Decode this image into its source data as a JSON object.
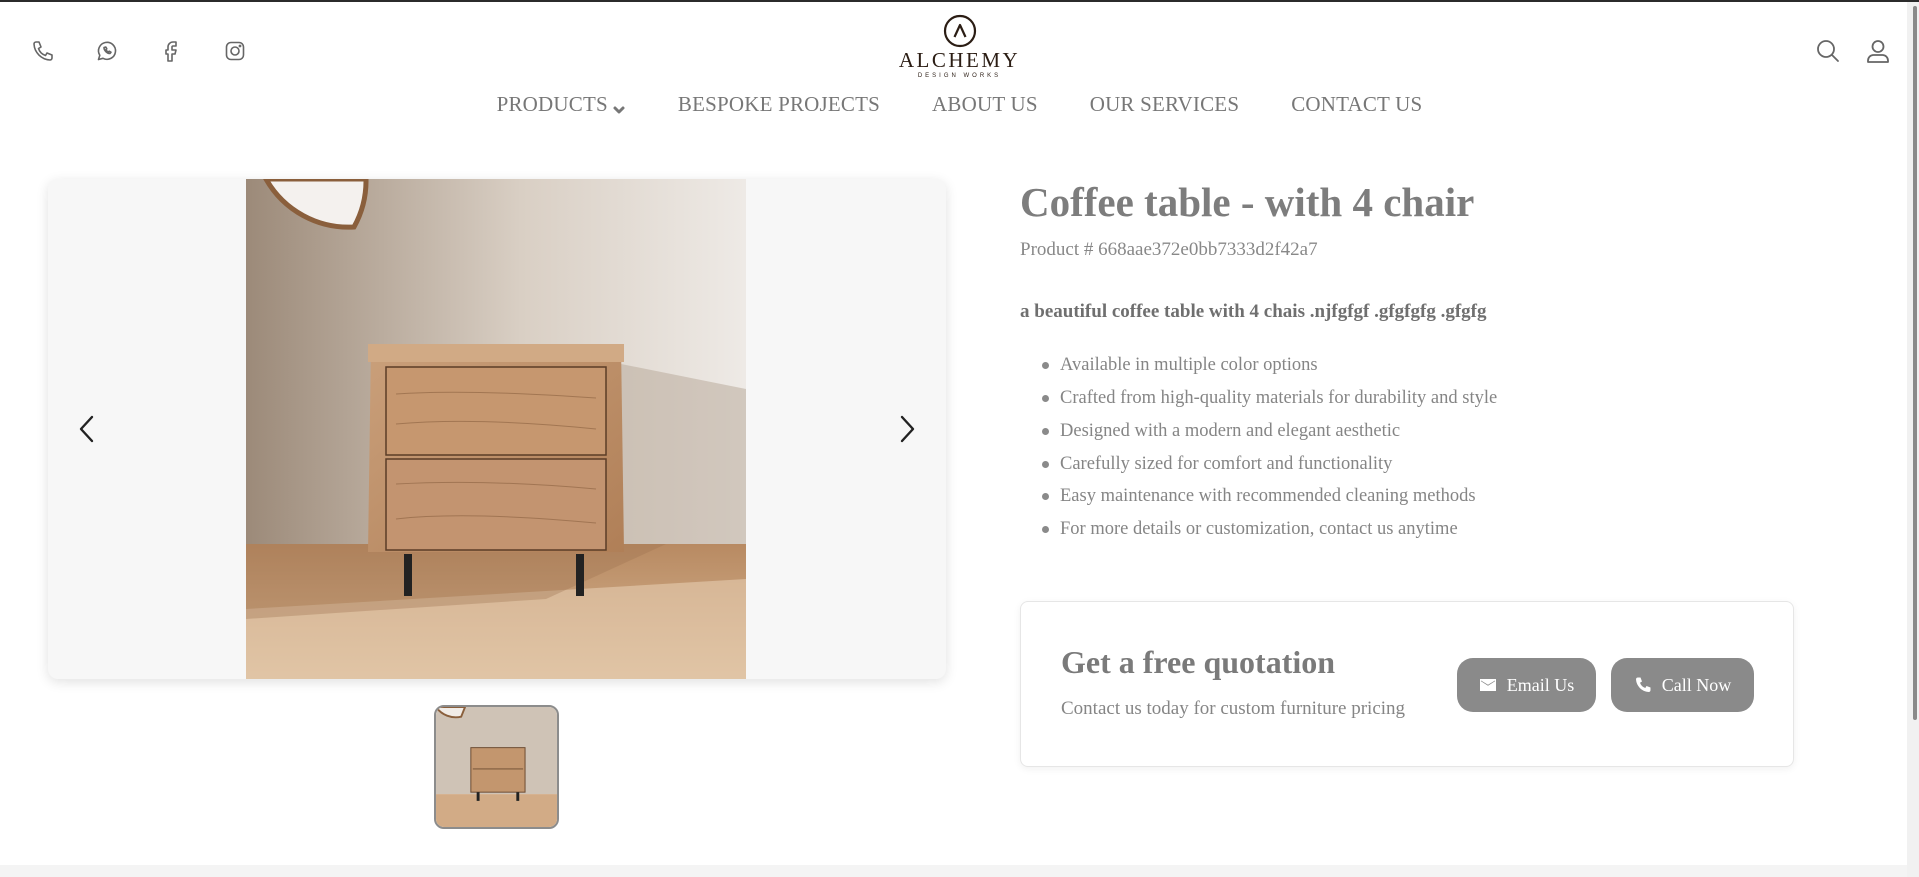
{
  "header": {
    "social_icons": [
      "phone-icon",
      "whatsapp-icon",
      "facebook-icon",
      "instagram-icon"
    ],
    "logo": {
      "name": "ALCHEMY",
      "tagline": "DESIGN WORKS"
    },
    "right_icons": [
      "search-icon",
      "user-icon"
    ]
  },
  "nav": {
    "items": [
      {
        "label": "PRODUCTS",
        "has_dropdown": true
      },
      {
        "label": "BESPOKE PROJECTS"
      },
      {
        "label": "ABOUT US"
      },
      {
        "label": "OUR SERVICES"
      },
      {
        "label": "CONTACT US"
      }
    ]
  },
  "gallery": {
    "prev_icon": "chevron-left-icon",
    "next_icon": "chevron-right-icon",
    "thumbnails": 1
  },
  "product": {
    "title": "Coffee table - with 4 chair",
    "number": "Product # 668aae372e0bb7333d2f42a7",
    "description": "a beautiful coffee table with 4 chais .njfgfgf .gfgfgfg .gfgfg",
    "features": [
      "Available in multiple color options",
      "Crafted from high-quality materials for durability and style",
      "Designed with a modern and elegant aesthetic",
      "Carefully sized for comfort and functionality",
      "Easy maintenance with recommended cleaning methods",
      "For more details or customization, contact us anytime"
    ]
  },
  "quote": {
    "title": "Get a free quotation",
    "subtitle": "Contact us today for custom furniture pricing",
    "email_label": "Email Us",
    "call_label": "Call Now"
  },
  "colors": {
    "text": "#7a7a7a",
    "button": "#8a8a8a",
    "logo": "#2b1d14",
    "gallery_bg": "#f7f7f7"
  }
}
